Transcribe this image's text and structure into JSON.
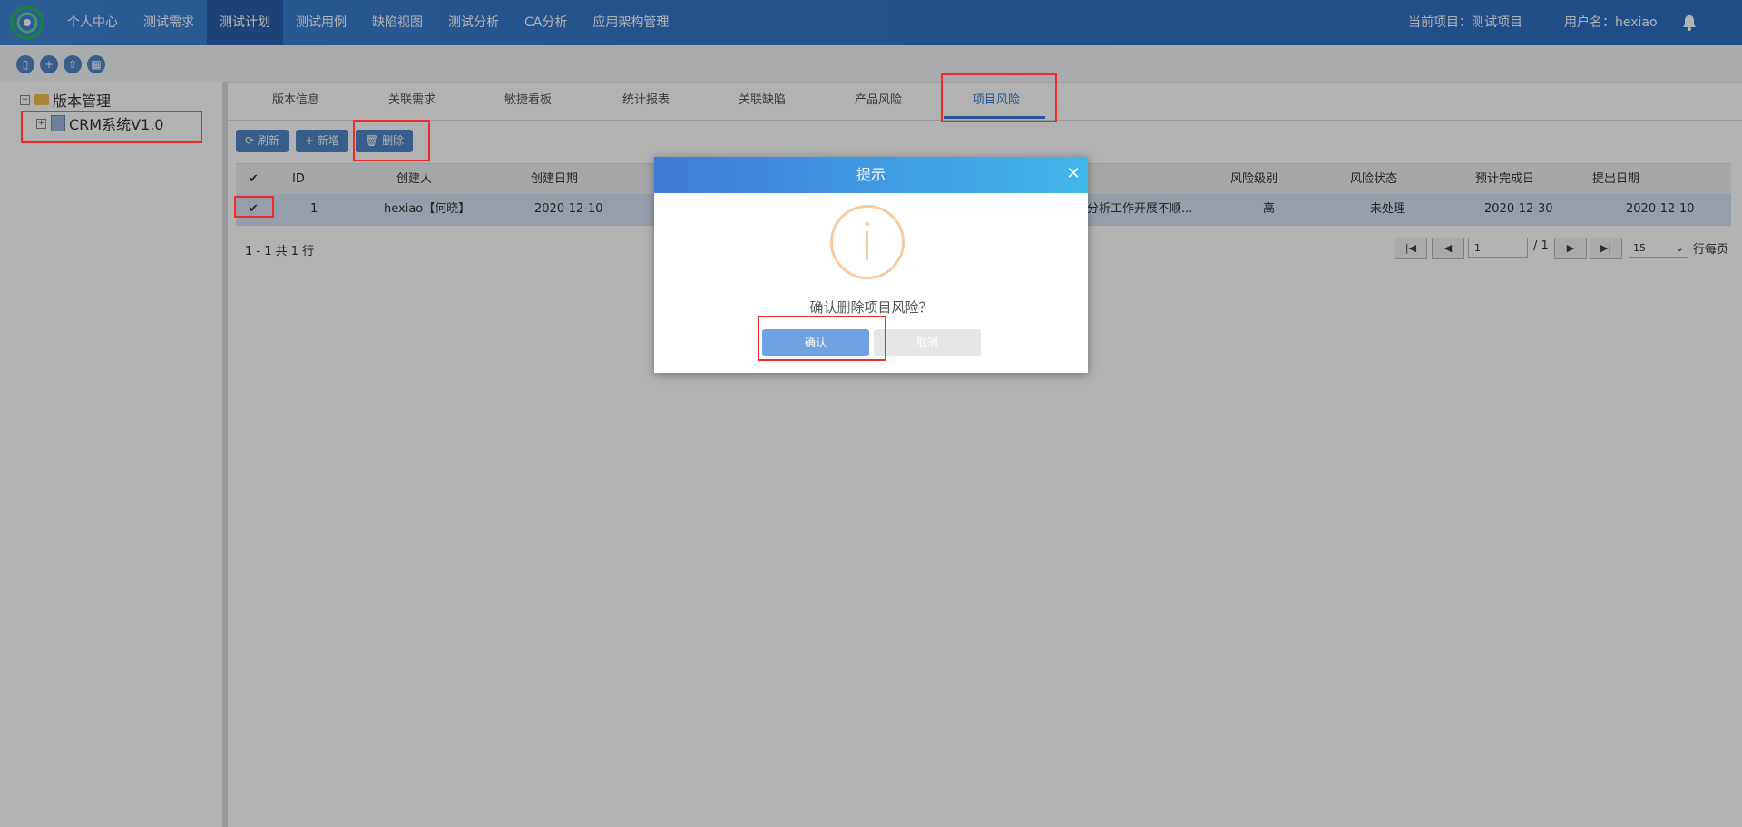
{
  "nav": {
    "items": [
      "个人中心",
      "测试需求",
      "测试计划",
      "测试用例",
      "缺陷视图",
      "测试分析",
      "CA分析",
      "应用架构管理"
    ],
    "active_index": 2,
    "current_project": "当前项目：测试项目",
    "username": "用户名：hexiao"
  },
  "tree": {
    "root": "版本管理",
    "child": "CRM系统V1.0"
  },
  "tabs": [
    "版本信息",
    "关联需求",
    "敏捷看板",
    "统计报表",
    "关联缺陷",
    "产品风险",
    "项目风险"
  ],
  "active_tab": "项目风险",
  "actions": {
    "refresh": "刷新",
    "add": "新增",
    "delete": "删除"
  },
  "table": {
    "headers": [
      "ID",
      "创建人",
      "创建日期",
      "风险级别",
      "风险状态",
      "预计完成日",
      "提出日期"
    ],
    "row": {
      "id": "1",
      "creator": "hexiao【何晓】",
      "created": "2020-12-10",
      "desc": "分析工作开展不顺...",
      "level": "高",
      "status": "未处理",
      "planned": "2020-12-30",
      "raised": "2020-12-10"
    }
  },
  "footer": {
    "count": "1 - 1 共 1 行",
    "page": "1",
    "total": "/ 1",
    "page_size": "15",
    "per_page": "行每页"
  },
  "modal": {
    "title": "提示",
    "message": "确认删除项目风险？",
    "ok": "确认",
    "cancel": "取消"
  },
  "colors": {
    "nav": "#3475c8",
    "accent": "#4f86c8",
    "highlight": "#ee2a2a"
  }
}
